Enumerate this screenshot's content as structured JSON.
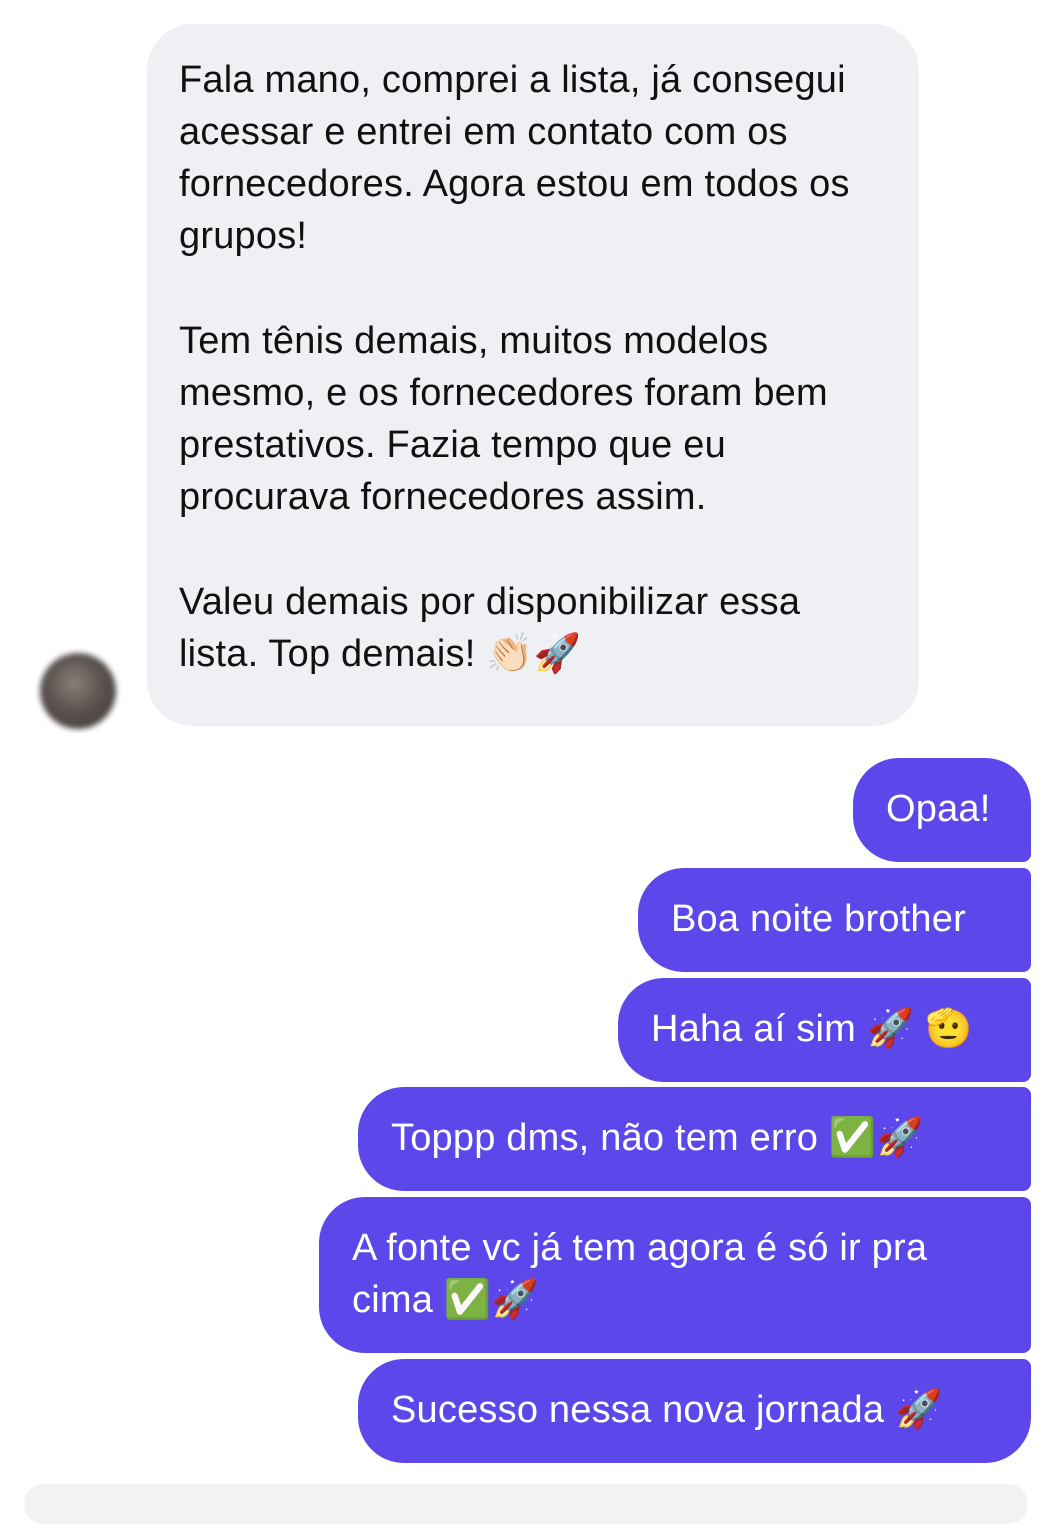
{
  "incoming_message": {
    "paragraphs": [
      "Fala mano, comprei a lista, já consegui acessar e entrei em contato com os fornecedores. Agora estou em todos os grupos!",
      "Tem tênis demais, muitos modelos mesmo, e os fornecedores foram bem prestativos. Fazia tempo que eu procurava fornecedores assim.",
      "Valeu demais por disponibilizar essa lista. Top demais! 👏🏻🚀"
    ]
  },
  "outgoing_messages": [
    "Opaa!",
    "Boa noite brother",
    "Haha aí sim 🚀 🫡",
    "Toppp dms, não tem erro ✅🚀",
    "A fonte vc já tem agora é só ir pra cima ✅🚀",
    "Sucesso nessa nova jornada 🚀"
  ],
  "colors": {
    "incoming_bubble": "#eff0f4",
    "outgoing_bubble": "#5c47ea",
    "incoming_text": "#111111",
    "outgoing_text": "#ffffff"
  }
}
